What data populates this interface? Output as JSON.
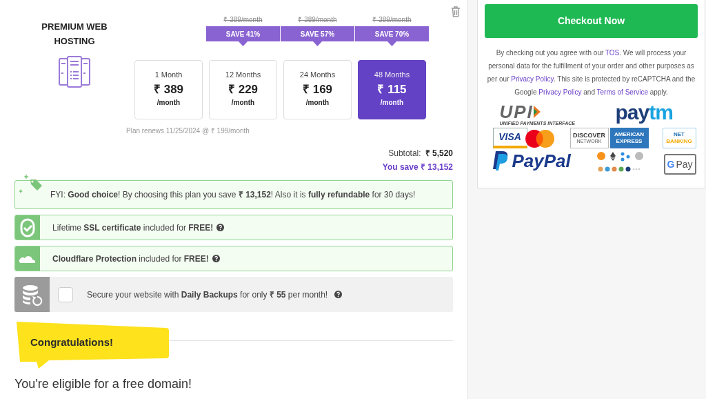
{
  "product": {
    "title": "PREMIUM WEB HOSTING"
  },
  "plans": [
    {
      "period": "1 Month",
      "price": "₹ 389",
      "unit": "/month",
      "selected": false
    },
    {
      "period": "12 Months",
      "price": "₹ 229",
      "unit": "/month",
      "old_price": "₹ 389/month",
      "save": "SAVE 41%",
      "selected": false
    },
    {
      "period": "24 Months",
      "price": "₹ 169",
      "unit": "/month",
      "old_price": "₹ 389/month",
      "save": "SAVE 57%",
      "selected": false
    },
    {
      "period": "48 Months",
      "price": "₹ 115",
      "unit": "/month",
      "old_price": "₹ 389/month",
      "save": "SAVE 70%",
      "selected": true
    }
  ],
  "renewal_note": "Plan renews 11/25/2024 @ ₹ 199/month",
  "subtotal": {
    "label": "Subtotal:",
    "value": "₹ 5,520"
  },
  "you_save": "You save ₹ 13,152",
  "notices": [
    {
      "kind": "tip",
      "text": "FYI: **Good choice**! By choosing this plan you save **₹ 13,152**! Also it is **fully refundable** for 30 days!"
    },
    {
      "kind": "ssl",
      "text": "Lifetime **SSL certificate** included for **FREE!**",
      "help": true
    },
    {
      "kind": "cloud",
      "text": "**Cloudflare Protection** included for **FREE!**",
      "help": true
    }
  ],
  "addon": {
    "text": "Secure your website with **Daily Backups** for only **₹ 55** per month!",
    "checked": false
  },
  "congrats": "Congratulations!",
  "domain_heading": "You're eligible for a free domain!",
  "checkout": {
    "button": "Checkout Now",
    "terms": [
      {
        "text": "By checking out you agree with our "
      },
      {
        "text": "TOS",
        "link": true
      },
      {
        "text": ". We will process your personal data for the fulfillment of your order and other purposes as per our "
      },
      {
        "text": "Privacy Policy",
        "link": true
      },
      {
        "text": ". This site is protected by reCAPTCHA and the Google "
      },
      {
        "text": "Privacy Policy",
        "link": true
      },
      {
        "text": " and "
      },
      {
        "text": "Terms of Service",
        "link": true
      },
      {
        "text": " apply."
      }
    ]
  },
  "payment_logos": [
    {
      "kind": "upi",
      "text": "UPI",
      "sub": "UNIFIED PAYMENTS INTERFACE"
    },
    {
      "kind": "paytm",
      "text": "pay",
      "text2": "tm"
    },
    {
      "kind": "visa",
      "text": "VISA"
    },
    {
      "kind": "mastercard"
    },
    {
      "kind": "discover",
      "text": "DISCOVER",
      "sub": "NETWORK"
    },
    {
      "kind": "amex",
      "text": "AMERICAN",
      "sub": "EXPRESS"
    },
    {
      "kind": "netbanking",
      "text": "NET",
      "sub": "BANKING"
    },
    {
      "kind": "paypal",
      "text": "PayPal"
    },
    {
      "kind": "crypto"
    },
    {
      "kind": "gpay",
      "text": "G",
      "text2": "Pay"
    }
  ]
}
